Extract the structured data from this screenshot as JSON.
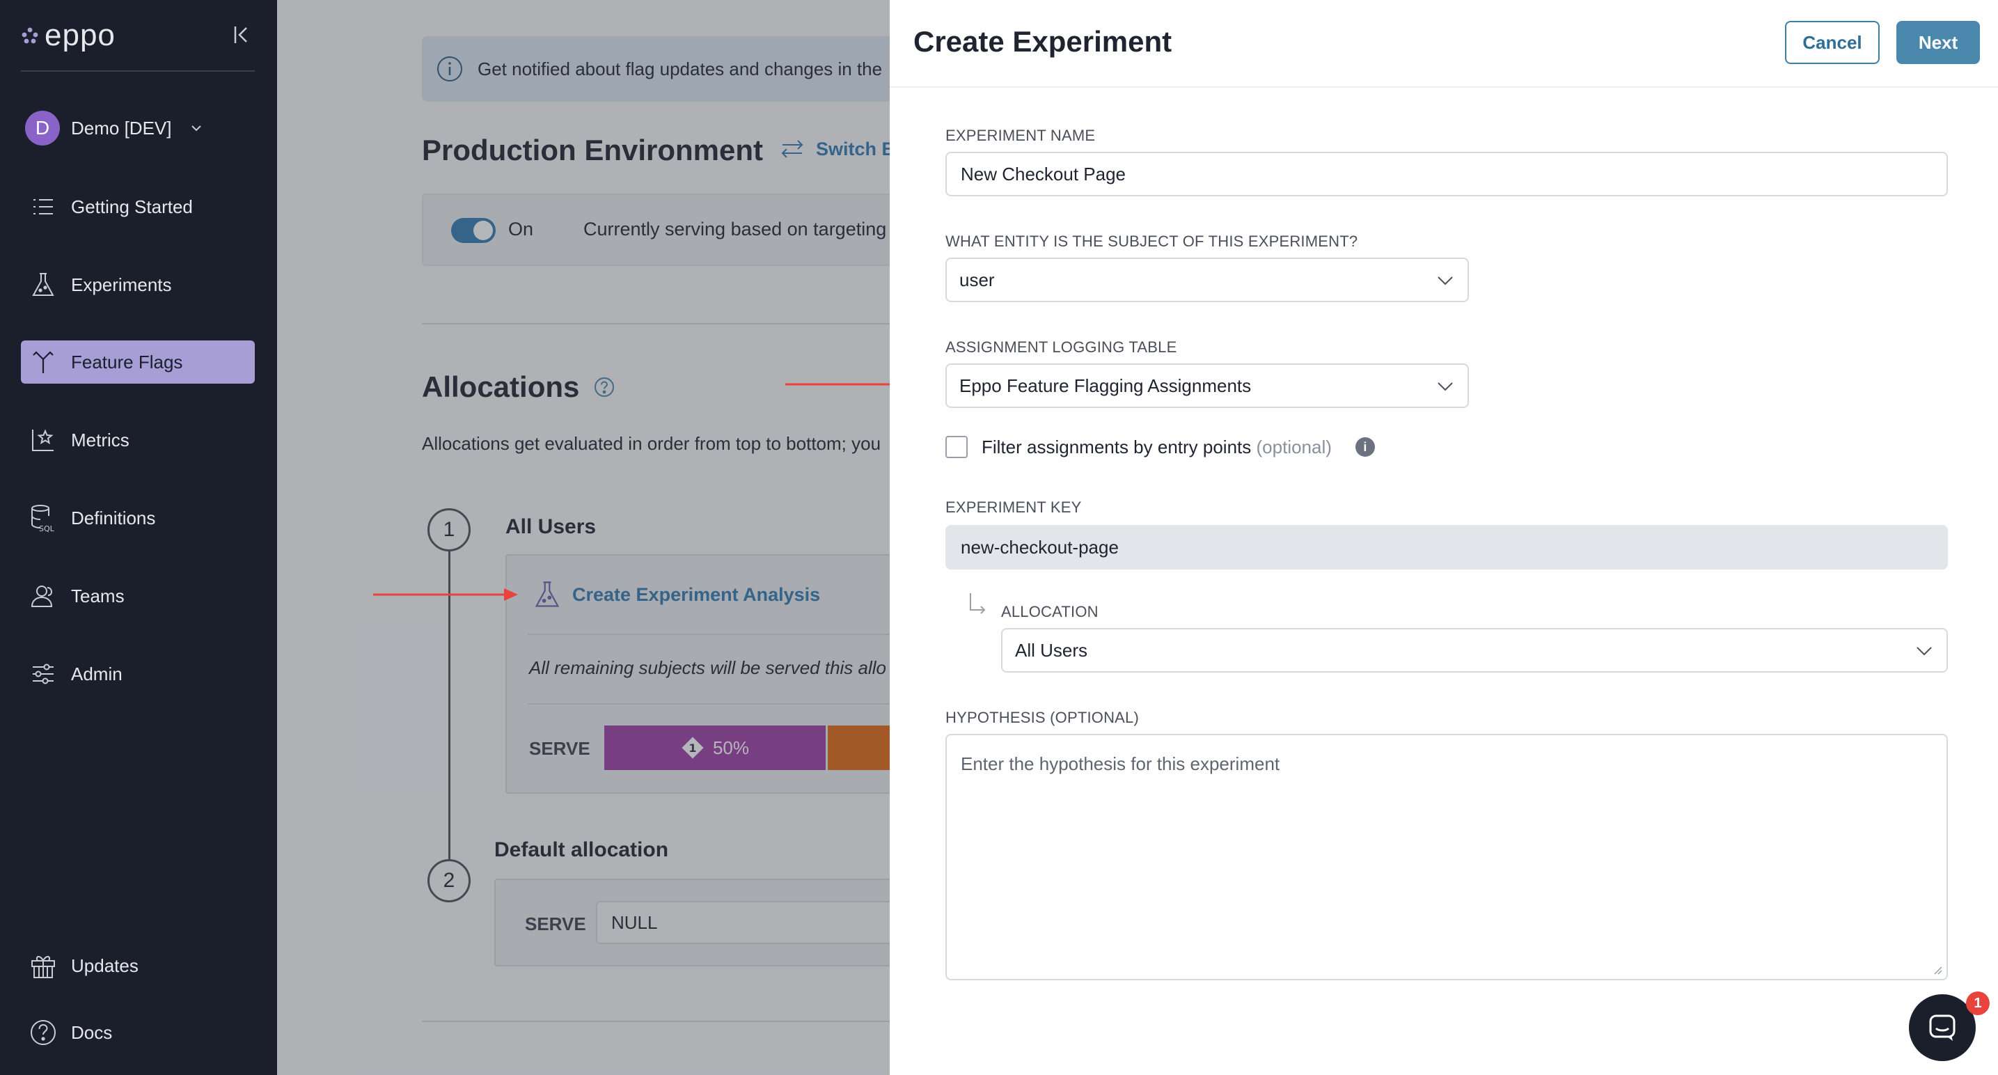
{
  "app": {
    "logo_text": "eppo"
  },
  "sidebar": {
    "workspace": {
      "initial": "D",
      "name": "Demo [DEV]"
    },
    "items": [
      {
        "label": "Getting Started",
        "icon": "list-icon"
      },
      {
        "label": "Experiments",
        "icon": "flask-icon"
      },
      {
        "label": "Feature Flags",
        "icon": "flag-branch-icon",
        "active": true
      },
      {
        "label": "Metrics",
        "icon": "chart-star-icon"
      },
      {
        "label": "Definitions",
        "icon": "database-sql-icon"
      },
      {
        "label": "Teams",
        "icon": "users-icon"
      },
      {
        "label": "Admin",
        "icon": "sliders-icon"
      }
    ],
    "bottom_items": [
      {
        "label": "Updates",
        "icon": "gift-icon"
      },
      {
        "label": "Docs",
        "icon": "help-circle-icon"
      }
    ]
  },
  "main": {
    "banner_text": "Get notified about flag updates and changes in the",
    "env_title": "Production Environment",
    "switch_env": "Switch En",
    "toggle_label": "On",
    "serving_text": "Currently serving based on targeting",
    "allocations_title": "Allocations",
    "allocations_desc": "Allocations get evaluated in order from top to bottom; you",
    "allocation1": {
      "step": "1",
      "name": "All Users",
      "link": "Create Experiment Analysis",
      "italic": "All remaining subjects will be served this allo",
      "serve_label": "SERVE",
      "variant_badge": "1",
      "variant_pct": "50%"
    },
    "allocation2": {
      "step": "2",
      "name": "Default allocation",
      "serve_label": "SERVE",
      "value": "NULL"
    }
  },
  "drawer": {
    "title": "Create Experiment",
    "cancel_label": "Cancel",
    "next_label": "Next",
    "experiment_name": {
      "label": "EXPERIMENT NAME",
      "value": "New Checkout Page"
    },
    "entity": {
      "label": "WHAT ENTITY IS THE SUBJECT OF THIS EXPERIMENT?",
      "value": "user"
    },
    "logging_table": {
      "label": "ASSIGNMENT LOGGING TABLE",
      "value": "Eppo Feature Flagging Assignments"
    },
    "filter": {
      "label": "Filter assignments by entry points",
      "optional": "(optional)",
      "info": "i"
    },
    "experiment_key": {
      "label": "EXPERIMENT KEY",
      "value": "new-checkout-page"
    },
    "allocation": {
      "label": "ALLOCATION",
      "value": "All Users"
    },
    "hypothesis": {
      "label": "HYPOTHESIS (OPTIONAL)",
      "placeholder": "Enter the hypothesis for this experiment"
    }
  },
  "chat": {
    "badge": "1"
  },
  "colors": {
    "sidebar_bg": "#1a1f2b",
    "active_nav": "#a79ed6",
    "link_blue": "#2f7bb2",
    "primary_button": "#4a87ad",
    "annotation_red": "#e8433c",
    "variant_purple": "#9b3ea6",
    "variant_orange": "#e26a14"
  }
}
